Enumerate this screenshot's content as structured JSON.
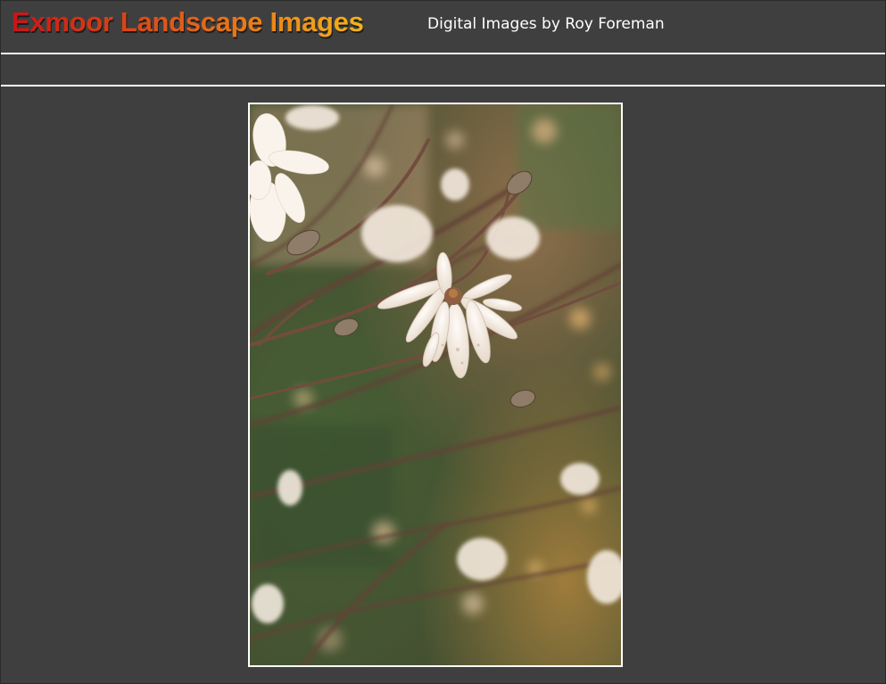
{
  "header": {
    "site_title": "Exmoor Landscape Images",
    "site_subtitle": "Digital Images by Roy Foreman"
  },
  "colors": {
    "page_background": "#3f3f3f",
    "title_gradient_start": "#c8141a",
    "title_gradient_end": "#f4b41c",
    "subtitle": "#ffffff",
    "rules": "#ffffff"
  },
  "main": {
    "photo": {
      "subject": "magnolia-blossom-photo"
    }
  }
}
